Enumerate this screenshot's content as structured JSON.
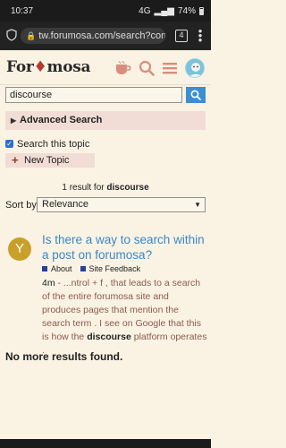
{
  "status_bar": {
    "time": "10:37",
    "signal": "4G",
    "battery": "74%"
  },
  "browser": {
    "url": "tw.forumosa.com/search?conte",
    "tab_count": "4"
  },
  "forum": {
    "logo_pre": "For",
    "logo_post": "mosa"
  },
  "search": {
    "query": "discourse"
  },
  "advanced": {
    "label": "Advanced Search"
  },
  "filter": {
    "checkbox_label": "Search this topic"
  },
  "new_topic": {
    "label": "New Topic"
  },
  "results": {
    "count_prefix": "1 result for",
    "term": "discourse"
  },
  "sort": {
    "label": "Sort by",
    "value": "Relevance"
  },
  "result_item": {
    "avatar_letter": "Y",
    "title": "Is there a way to search within a post on forumosa?",
    "categories": [
      "About",
      "Site Feedback"
    ],
    "category_color": "#25419a",
    "age": "4m",
    "blurb_before": " - ...ntrol + f , that leads to a search of the entire forumosa site and produces pages that mention the search term . I see on Google that this is how the ",
    "blurb_term": "discourse",
    "blurb_after": " platform operates ."
  },
  "footer": {
    "no_more": "No more results found."
  },
  "colors": {
    "accent": "#3b8fd1",
    "link": "#3a87c8",
    "badge_bg": "#f2dcd6",
    "background": "#faf3e3",
    "avatar": "#c9a02a"
  }
}
